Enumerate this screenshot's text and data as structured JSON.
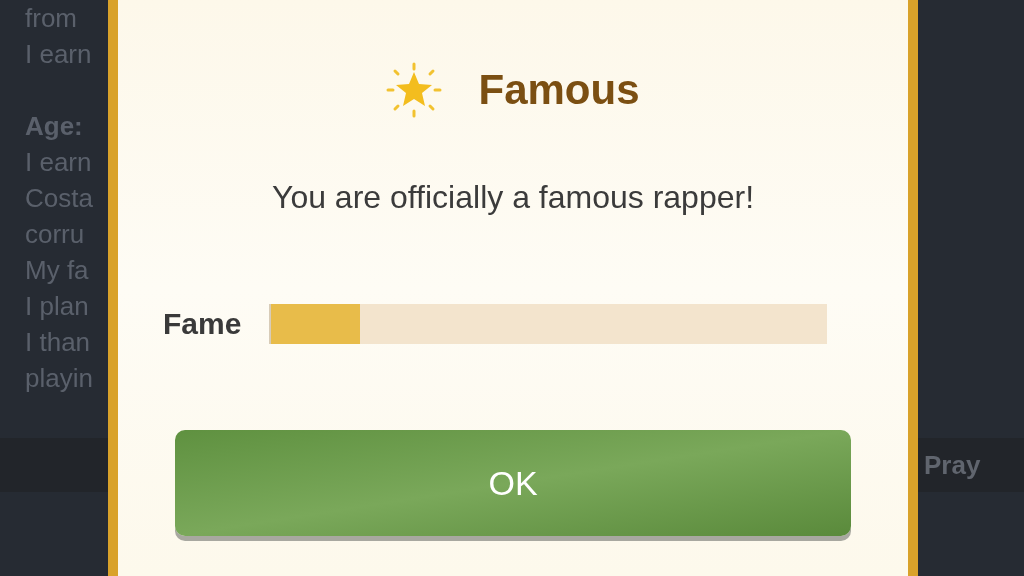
{
  "background": {
    "lines": [
      {
        "kind": "text",
        "text": "from"
      },
      {
        "kind": "text",
        "text": "I earn"
      },
      {
        "kind": "gap"
      },
      {
        "kind": "heading",
        "text": "Age:"
      },
      {
        "kind": "text",
        "text": "I earn"
      },
      {
        "kind": "text",
        "text": "Costa"
      },
      {
        "kind": "text",
        "text": "corru"
      },
      {
        "kind": "text",
        "text": "My fa"
      },
      {
        "kind": "text",
        "text": "I plan"
      },
      {
        "kind": "text",
        "text": "I than"
      },
      {
        "kind": "text",
        "text": "playin"
      }
    ],
    "right_button": "Pray"
  },
  "dialog": {
    "title": "Famous",
    "message": "You are officially a famous rapper!",
    "meter": {
      "label": "Fame",
      "level": 0.16
    },
    "button": "OK"
  }
}
